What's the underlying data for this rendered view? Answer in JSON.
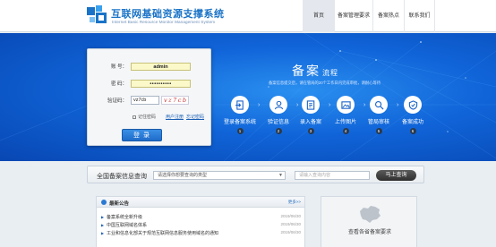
{
  "header": {
    "title": "互联网基础资源支撑系统",
    "subtitle": "Internet Basic Resource Monitor Management System",
    "nav": [
      "首页",
      "备案管理要求",
      "备案热点",
      "联系我们"
    ],
    "active_nav": 0
  },
  "login": {
    "username_label": "账 号：",
    "username_value": "admin",
    "password_label": "密 码：",
    "password_value": "••••••••••",
    "captcha_label": "验证码：",
    "captcha_value": "vz7cb",
    "captcha_image_text": "vz7cb",
    "remember_label": "记住密码",
    "register_link": "用户注册",
    "forgot_link": "忘记密码",
    "login_button": "登 录"
  },
  "process": {
    "title": "备案",
    "title_suffix": "流程",
    "desc": "备案信息提交后，请在管局的20个工作日内完成审批，请耐心等待",
    "steps": [
      {
        "label": "登录备案系统",
        "num": "1",
        "icon": "login-icon"
      },
      {
        "label": "验证信息",
        "num": "2",
        "icon": "verify-icon"
      },
      {
        "label": "录入备案",
        "num": "3",
        "icon": "edit-icon"
      },
      {
        "label": "上传图片",
        "num": "4",
        "icon": "upload-icon"
      },
      {
        "label": "管局审核",
        "num": "5",
        "icon": "review-icon"
      },
      {
        "label": "备案成功",
        "num": "6",
        "icon": "success-icon"
      }
    ]
  },
  "query": {
    "title": "全国备案信息查询",
    "select_placeholder": "请选择你想要查询的类型",
    "input_placeholder": "请输入查询内容",
    "button": "马上查询"
  },
  "notice": {
    "title": "最新公告",
    "more": "更多>>",
    "items": [
      {
        "text": "备案系统全新升级",
        "date": "2019/06/30"
      },
      {
        "text": "中国互联网域名体系",
        "date": "2019/06/30"
      },
      {
        "text": "工业和信息化部关于规范互联网信息服务使用域名的通知",
        "date": "2019/06/30"
      }
    ]
  },
  "map_card": {
    "label": "查看各省备案要求"
  },
  "colors": {
    "brand_blue": "#1a73c7",
    "banner_blue": "#1064d8",
    "input_yellow": "#fbf8c9"
  }
}
